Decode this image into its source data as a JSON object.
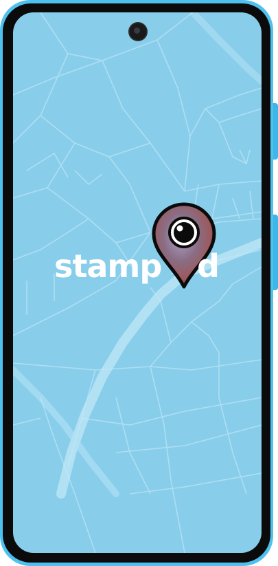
{
  "splash": {
    "logo_left": "stamp",
    "logo_right": "d",
    "logo_pin_icon": "map-pin-camera-icon"
  },
  "colors": {
    "frame_accent": "#4fc1ee",
    "screen_background": "#88ceeb",
    "map_lines": "#b6e2f5",
    "logo_text": "#ffffff"
  }
}
